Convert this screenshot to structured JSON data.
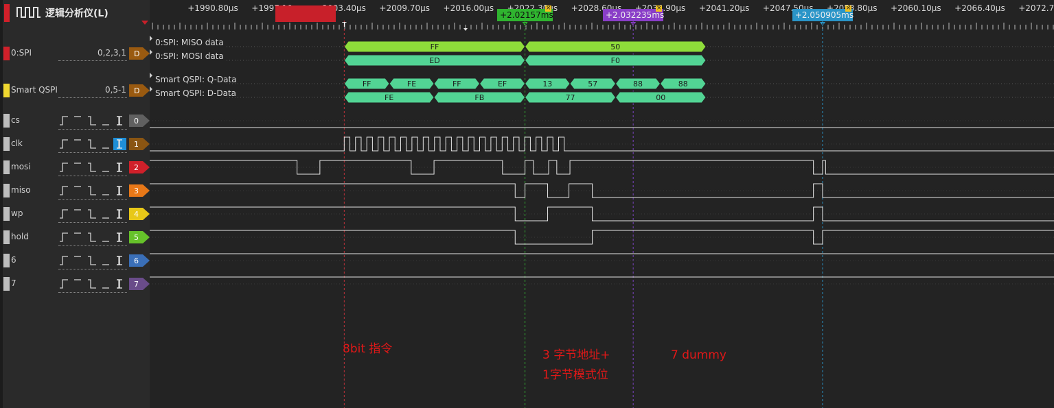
{
  "app": {
    "title": "逻辑分析仪(L)",
    "title_icon": "waveform-icon"
  },
  "ruler": {
    "labels": [
      {
        "text": "+1990.80µs",
        "at": 1990.8
      },
      {
        "text": "+1997.10µs",
        "at": 1997.1
      },
      {
        "text": "+2003.40µs",
        "at": 2003.4
      },
      {
        "text": "+2009.70µs",
        "at": 2009.7
      },
      {
        "text": "+2016.00µs",
        "at": 2016.0
      },
      {
        "text": "+2022.30µs",
        "at": 2022.3
      },
      {
        "text": "+2028.60µs",
        "at": 2028.6
      },
      {
        "text": "+2034.90µs",
        "at": 2034.9
      },
      {
        "text": "+2041.20µs",
        "at": 2041.2
      },
      {
        "text": "+2047.50µs",
        "at": 2047.5
      },
      {
        "text": "+2053.80µs",
        "at": 2053.8
      },
      {
        "text": "+2060.10µs",
        "at": 2060.1
      },
      {
        "text": "+2066.40µs",
        "at": 2066.4
      },
      {
        "text": "+2072.70µs",
        "at": 2072.7
      }
    ]
  },
  "cursors": [
    {
      "label": "+2.02157ms",
      "color": "#2fb42f",
      "line_color": "#33aa33",
      "at": 2021.57,
      "marker": "2"
    },
    {
      "label": "+2.032235ms",
      "color": "#8a3ec8",
      "line_color": "#7a42c0",
      "at": 2032.235,
      "marker": "3"
    },
    {
      "label": "+2.050905ms",
      "color": "#2a95c8",
      "line_color": "#2a8fc0",
      "at": 2050.905,
      "marker": "4"
    }
  ],
  "trigger": {
    "color": "#c8202a",
    "line_color": "#c0303a",
    "label": "T",
    "at": 2003.75
  },
  "protocols": [
    {
      "name": "0:SPI",
      "color": "#d0202a",
      "pins": "0,2,3,1",
      "badge": "D",
      "rows": [
        {
          "label": "0:SPI: MISO data",
          "color": "#8edc3a",
          "cells": [
            {
              "text": "FF",
              "t0": 2003.75,
              "t1": 2021.57
            },
            {
              "text": "50",
              "t0": 2021.57,
              "t1": 2039.4
            }
          ]
        },
        {
          "label": "0:SPI: MOSI data",
          "color": "#52d494",
          "cells": [
            {
              "text": "ED",
              "t0": 2003.75,
              "t1": 2021.57
            },
            {
              "text": "F0",
              "t0": 2021.57,
              "t1": 2039.4
            }
          ]
        }
      ]
    },
    {
      "name": "Smart QSPI",
      "color": "#f0d830",
      "pins": "0,5-1",
      "badge": "D",
      "rows": [
        {
          "label": "Smart QSPI: Q-Data",
          "color": "#52d494",
          "cells": [
            {
              "text": "FF",
              "t0": 2003.75,
              "t1": 2008.2
            },
            {
              "text": "FE",
              "t0": 2008.2,
              "t1": 2012.6
            },
            {
              "text": "FF",
              "t0": 2012.6,
              "t1": 2017.1
            },
            {
              "text": "EF",
              "t0": 2017.1,
              "t1": 2021.57
            },
            {
              "text": "13",
              "t0": 2021.57,
              "t1": 2026.0
            },
            {
              "text": "57",
              "t0": 2026.0,
              "t1": 2030.5
            },
            {
              "text": "88",
              "t0": 2030.5,
              "t1": 2034.9
            },
            {
              "text": "88",
              "t0": 2034.9,
              "t1": 2039.4
            }
          ]
        },
        {
          "label": "Smart QSPI: D-Data",
          "color": "#52d494",
          "cells": [
            {
              "text": "FE",
              "t0": 2003.75,
              "t1": 2012.6
            },
            {
              "text": "FB",
              "t0": 2012.6,
              "t1": 2021.57
            },
            {
              "text": "77",
              "t0": 2021.57,
              "t1": 2030.5
            },
            {
              "text": "00",
              "t0": 2030.5,
              "t1": 2039.4
            }
          ]
        }
      ]
    }
  ],
  "channels": [
    {
      "name": "cs",
      "index": "0",
      "color": "#606060",
      "active_trigger": false,
      "wave": [
        [
          1990.0,
          0
        ]
      ]
    },
    {
      "name": "clk",
      "index": "1",
      "color": "#8a5512",
      "active_trigger": true,
      "wave": "clock"
    },
    {
      "name": "mosi",
      "index": "2",
      "color": "#d0202a",
      "active_trigger": false,
      "wave": [
        [
          1990.0,
          1
        ],
        [
          1999.1,
          0
        ],
        [
          2001.35,
          1
        ],
        [
          2010.35,
          0
        ],
        [
          2012.6,
          1
        ],
        [
          2019.35,
          0
        ],
        [
          2021.57,
          1
        ],
        [
          2022.4,
          0
        ],
        [
          2023.9,
          1
        ],
        [
          2024.7,
          0
        ],
        [
          2026.0,
          1
        ],
        [
          2050.0,
          0
        ],
        [
          2050.9,
          1
        ],
        [
          2051.2,
          0
        ]
      ]
    },
    {
      "name": "miso",
      "index": "3",
      "color": "#e87818",
      "active_trigger": false,
      "wave": [
        [
          1990.0,
          1
        ],
        [
          2020.6,
          0
        ],
        [
          2021.57,
          1
        ],
        [
          2023.8,
          0
        ],
        [
          2025.9,
          1
        ],
        [
          2028.2,
          0
        ],
        [
          2050.0,
          1
        ],
        [
          2050.9,
          0
        ]
      ]
    },
    {
      "name": "wp",
      "index": "4",
      "color": "#e8c818",
      "active_trigger": false,
      "wave": [
        [
          1990.0,
          1
        ],
        [
          2020.6,
          0
        ],
        [
          2023.8,
          1
        ],
        [
          2028.2,
          0
        ],
        [
          2050.0,
          1
        ],
        [
          2050.9,
          0
        ]
      ]
    },
    {
      "name": "hold",
      "index": "5",
      "color": "#66c22a",
      "active_trigger": false,
      "wave": [
        [
          1990.0,
          1
        ],
        [
          2020.6,
          0
        ],
        [
          2028.2,
          1
        ],
        [
          2050.0,
          0
        ],
        [
          2050.9,
          1
        ],
        [
          2051.2,
          1
        ]
      ]
    },
    {
      "name": "6",
      "index": "6",
      "color": "#3a6fb8",
      "active_trigger": false,
      "wave": [
        [
          1990.0,
          1
        ]
      ]
    },
    {
      "name": "7",
      "index": "7",
      "color": "#6a4c8a",
      "active_trigger": false,
      "wave": [
        [
          1990.0,
          1
        ]
      ]
    }
  ],
  "clock": {
    "start": 2003.75,
    "half_period": 0.556,
    "cycles": 20
  },
  "annotations": [
    {
      "text": "8bit 指令",
      "color": "#e01818"
    },
    {
      "text": "3 字节地址+",
      "color": "#e01818"
    },
    {
      "text": "1字节模式位",
      "color": "#e01818"
    },
    {
      "text": "7 dummy",
      "color": "#e01818"
    }
  ]
}
